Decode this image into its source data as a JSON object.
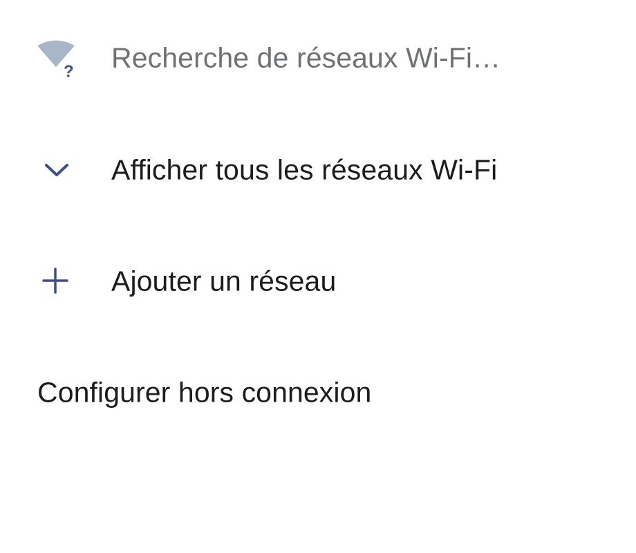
{
  "wifi_list": {
    "scanning": {
      "label": "Recherche de réseaux Wi-Fi…",
      "icon": "wifi-unknown-icon"
    },
    "show_all": {
      "label": "Afficher tous les réseaux Wi-Fi",
      "icon": "chevron-down-icon"
    },
    "add_network": {
      "label": "Ajouter un réseau",
      "icon": "plus-icon"
    },
    "offline_setup": {
      "label": "Configurer hors connexion"
    }
  },
  "colors": {
    "accent": "#3f4f86",
    "wifi_icon": "#a9b6c7",
    "secondary_text": "#6f7173",
    "primary_text": "#1b1c1e",
    "background": "#ffffff"
  }
}
